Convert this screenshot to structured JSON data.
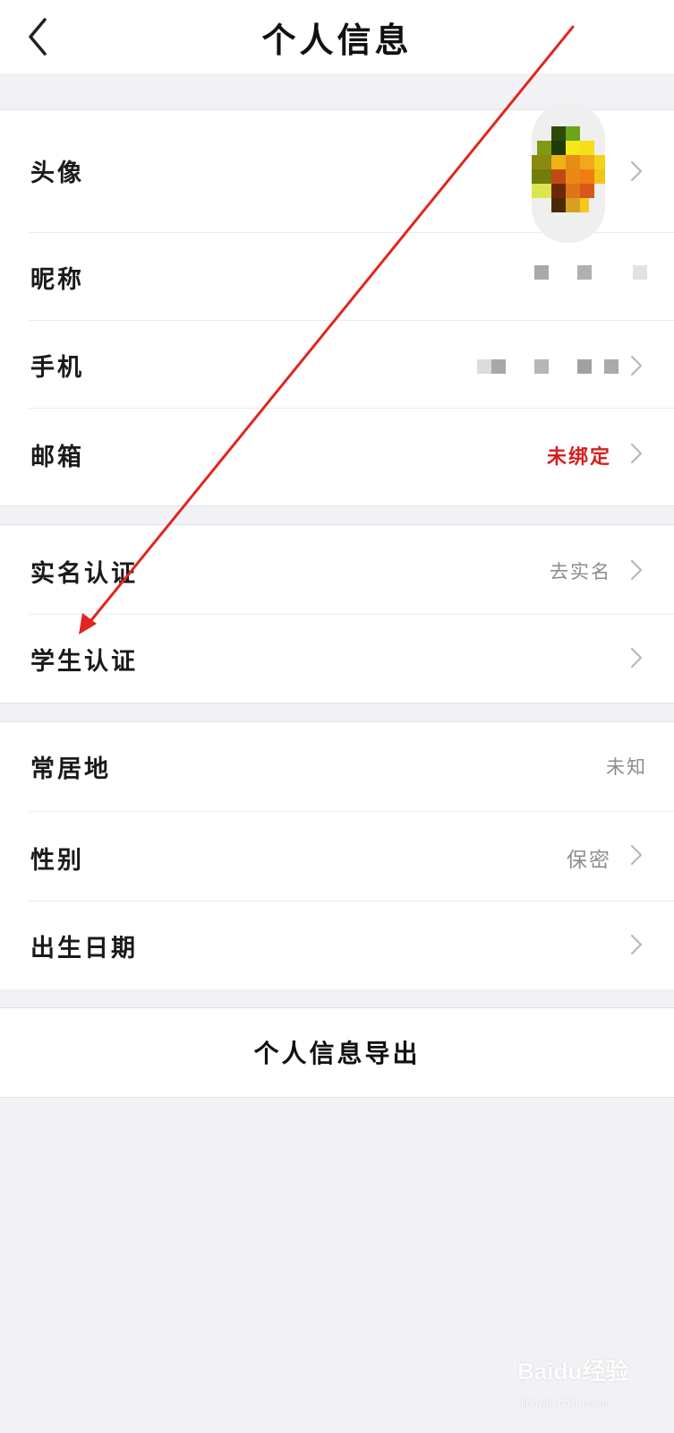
{
  "header": {
    "title": "个人信息"
  },
  "group1": {
    "avatar_label": "头像",
    "nickname_label": "昵称",
    "phone_label": "手机",
    "email_label": "邮箱",
    "email_value": "未绑定"
  },
  "group2": {
    "realname_label": "实名认证",
    "realname_value": "去实名",
    "student_label": "学生认证"
  },
  "group3": {
    "residence_label": "常居地",
    "residence_value": "未知",
    "gender_label": "性别",
    "gender_value": "保密",
    "birthday_label": "出生日期"
  },
  "export": {
    "label": "个人信息导出"
  },
  "watermark": {
    "text": "Baidu经验",
    "sub": "jingyan.baidu.com"
  },
  "colors": {
    "accent_red": "#d41f1f",
    "background": "#f2f2f6",
    "annotation_arrow": "#e0261f"
  }
}
